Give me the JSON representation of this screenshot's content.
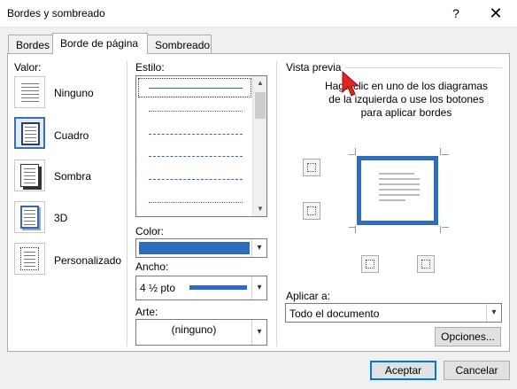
{
  "window": {
    "title": "Bordes y sombreado",
    "help": "?",
    "close": "✕"
  },
  "tabs": [
    {
      "label": "Bordes"
    },
    {
      "label": "Borde de página"
    },
    {
      "label": "Sombreado"
    }
  ],
  "setting": {
    "heading": "Valor:",
    "items": [
      {
        "label": "Ninguno"
      },
      {
        "label": "Cuadro"
      },
      {
        "label": "Sombra"
      },
      {
        "label": "3D"
      },
      {
        "label": "Personalizado"
      }
    ],
    "selected": "Cuadro"
  },
  "style": {
    "heading": "Estilo:",
    "color_label": "Color:",
    "color_value": "#2e6cbd",
    "width_label": "Ancho:",
    "width_value": "4 ½ pto",
    "art_label": "Arte:",
    "art_value": "(ninguno)"
  },
  "preview": {
    "heading": "Vista previa",
    "instructions": "Haga clic en uno de los diagramas de la izquierda o use los botones para aplicar bordes",
    "apply_label": "Aplicar a:",
    "apply_value": "Todo el documento",
    "options_button": "Opciones..."
  },
  "footer": {
    "ok": "Aceptar",
    "cancel": "Cancelar"
  }
}
